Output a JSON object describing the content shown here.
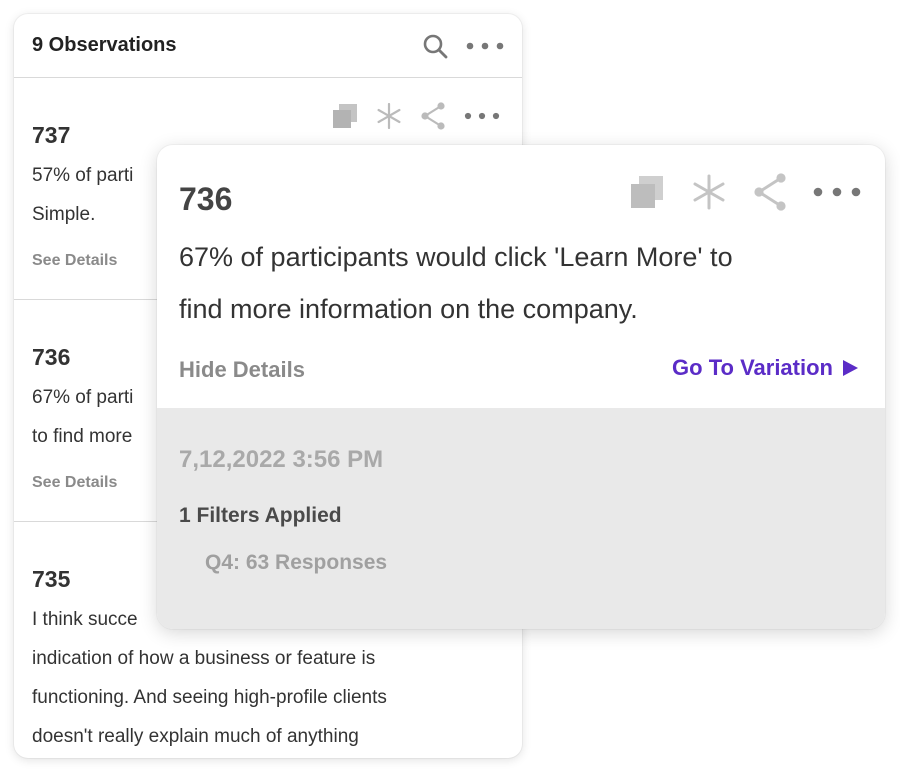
{
  "panel": {
    "title": "9 Observations",
    "header_icons": [
      "search-icon",
      "more-icon"
    ]
  },
  "observations": [
    {
      "number": "737",
      "line1": "57% of parti",
      "line2": "Simple.",
      "details": "See Details"
    },
    {
      "number": "736",
      "line1": "67% of parti",
      "line2": "to find more",
      "details": "See Details"
    },
    {
      "number": "735",
      "lines": [
        "I think succe",
        "indication of how a business or feature is",
        "functioning. And seeing high-profile clients",
        "doesn't really explain much of anything"
      ]
    }
  ],
  "card": {
    "number": "736",
    "text_line1": "67% of participants would click 'Learn More' to",
    "text_line2": "find more information on the company.",
    "hide_details": "Hide Details",
    "go_to_variation": "Go To Variation",
    "date": "7,12,2022 3:56 PM",
    "filters": "1 Filters Applied",
    "responses": "Q4: 63 Responses",
    "icons": [
      "copy-icon",
      "asterisk-icon",
      "share-icon",
      "more-icon"
    ]
  },
  "colors": {
    "accent": "#5b2cc7",
    "muted": "#8a8a8a",
    "details_bg": "#e9e9e9"
  }
}
